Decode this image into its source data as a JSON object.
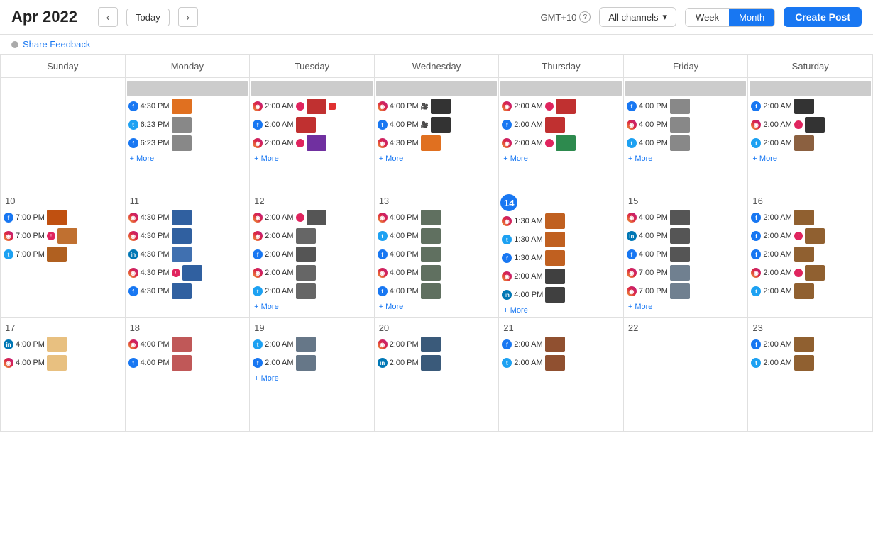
{
  "header": {
    "title": "Apr 2022",
    "today_label": "Today",
    "gmt": "GMT+10",
    "channels_label": "All channels",
    "week_label": "Week",
    "month_label": "Month",
    "create_label": "Create Post"
  },
  "feedback": {
    "label": "Share Feedback"
  },
  "days": [
    "Sunday",
    "Monday",
    "Tuesday",
    "Wednesday",
    "Thursday",
    "Friday",
    "Saturday"
  ],
  "calendar": {
    "week1": {
      "dates": [
        "",
        "",
        "",
        "",
        "",
        "",
        ""
      ],
      "events": {
        "mon": [
          {
            "icon": "fb",
            "time": "4:30 PM",
            "thumb": "orange",
            "notif": false
          },
          {
            "icon": "tw",
            "time": "6:23 PM",
            "thumb": "gray",
            "notif": false
          },
          {
            "icon": "fb",
            "time": "6:23 PM",
            "thumb": "gray",
            "notif": false
          }
        ],
        "tue": [
          {
            "icon": "ig",
            "time": "2:00 AM",
            "thumb": "red",
            "notif": true,
            "stop": true
          },
          {
            "icon": "fb",
            "time": "2:00 AM",
            "thumb": "red",
            "notif": false,
            "stop": false
          },
          {
            "icon": "ig",
            "time": "2:00 AM",
            "thumb": "purple",
            "notif": true,
            "stop": false
          }
        ],
        "wed": [
          {
            "icon": "ig",
            "time": "4:00 PM",
            "thumb": "dark",
            "notif": false,
            "video": true
          },
          {
            "icon": "fb",
            "time": "4:00 PM",
            "thumb": "dark",
            "notif": false,
            "video": true
          },
          {
            "icon": "ig",
            "time": "4:30 PM",
            "thumb": "orange2",
            "notif": false
          }
        ],
        "thu": [
          {
            "icon": "ig",
            "time": "2:00 AM",
            "thumb": "red2",
            "notif": true
          },
          {
            "icon": "fb",
            "time": "2:00 AM",
            "thumb": "red2",
            "notif": false
          },
          {
            "icon": "ig",
            "time": "2:00 AM",
            "thumb": "green",
            "notif": true
          }
        ],
        "fri": [
          {
            "icon": "fb",
            "time": "4:00 PM",
            "thumb": "gray2",
            "notif": false
          },
          {
            "icon": "ig",
            "time": "4:00 PM",
            "thumb": "gray2",
            "notif": false
          },
          {
            "icon": "tw",
            "time": "4:00 PM",
            "thumb": "gray2",
            "notif": false
          }
        ],
        "sat": [
          {
            "icon": "fb",
            "time": "2:00 AM",
            "thumb": "dark2",
            "notif": false
          },
          {
            "icon": "ig",
            "time": "2:00 AM",
            "thumb": "dark2",
            "notif": true
          },
          {
            "icon": "tw",
            "time": "2:00 AM",
            "thumb": "brown",
            "notif": false
          }
        ]
      }
    }
  },
  "more_label": "+ More"
}
